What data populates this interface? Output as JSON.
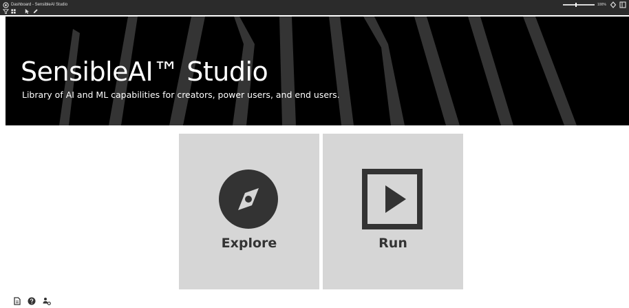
{
  "window": {
    "title": "Dashboard - SensibleAI Studio",
    "zoom": "100%",
    "icons": [
      "app-icon",
      "settings-icon",
      "panel-icon"
    ]
  },
  "toolbar": {
    "icons": [
      "filter-icon",
      "grid-icon",
      "pointer-icon",
      "pencil-icon"
    ]
  },
  "banner": {
    "title": "SensibleAI™ Studio",
    "subtitle": "Library of AI and ML capabilities for creators, power users, and end users."
  },
  "tiles": [
    {
      "label": "Explore",
      "icon": "compass-icon"
    },
    {
      "label": "Run",
      "icon": "play-icon"
    }
  ],
  "footer": {
    "icons": [
      "document-icon",
      "help-icon",
      "user-settings-icon"
    ]
  },
  "colors": {
    "banner_bg": "#000000",
    "tile_bg": "#d6d6d6",
    "icon_dark": "#333333",
    "titlebar_bg": "#2b2b2b"
  }
}
